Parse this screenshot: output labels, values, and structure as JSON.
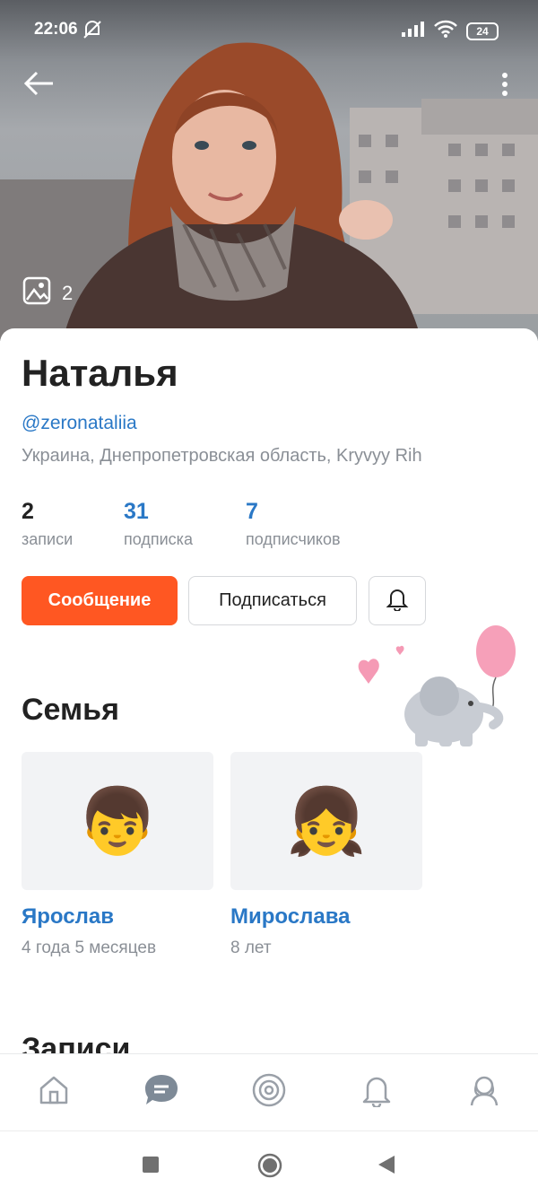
{
  "status_bar": {
    "time": "22:06",
    "battery": "24"
  },
  "hero": {
    "photo_count": "2"
  },
  "profile": {
    "name": "Наталья",
    "handle": "@zeronataliia",
    "location": "Украина, Днепропетровская область, Kryvyy Rih"
  },
  "stats": [
    {
      "value": "2",
      "label": "записи"
    },
    {
      "value": "31",
      "label": "подписка"
    },
    {
      "value": "7",
      "label": "подписчиков"
    }
  ],
  "actions": {
    "message_label": "Сообщение",
    "subscribe_label": "Подписаться"
  },
  "family": {
    "title": "Семья",
    "members": [
      {
        "name": "Ярослав",
        "age": "4 года 5 месяцев",
        "emoji": "👦"
      },
      {
        "name": "Мирослава",
        "age": "8 лет",
        "emoji": "👧"
      }
    ]
  },
  "records_title": "Записи",
  "colors": {
    "accent": "#ff5722",
    "link": "#2a78c6",
    "muted": "#8a8f96"
  },
  "bottom_nav": [
    "home-icon",
    "messages-icon",
    "discover-icon",
    "notifications-icon",
    "profile-icon"
  ]
}
